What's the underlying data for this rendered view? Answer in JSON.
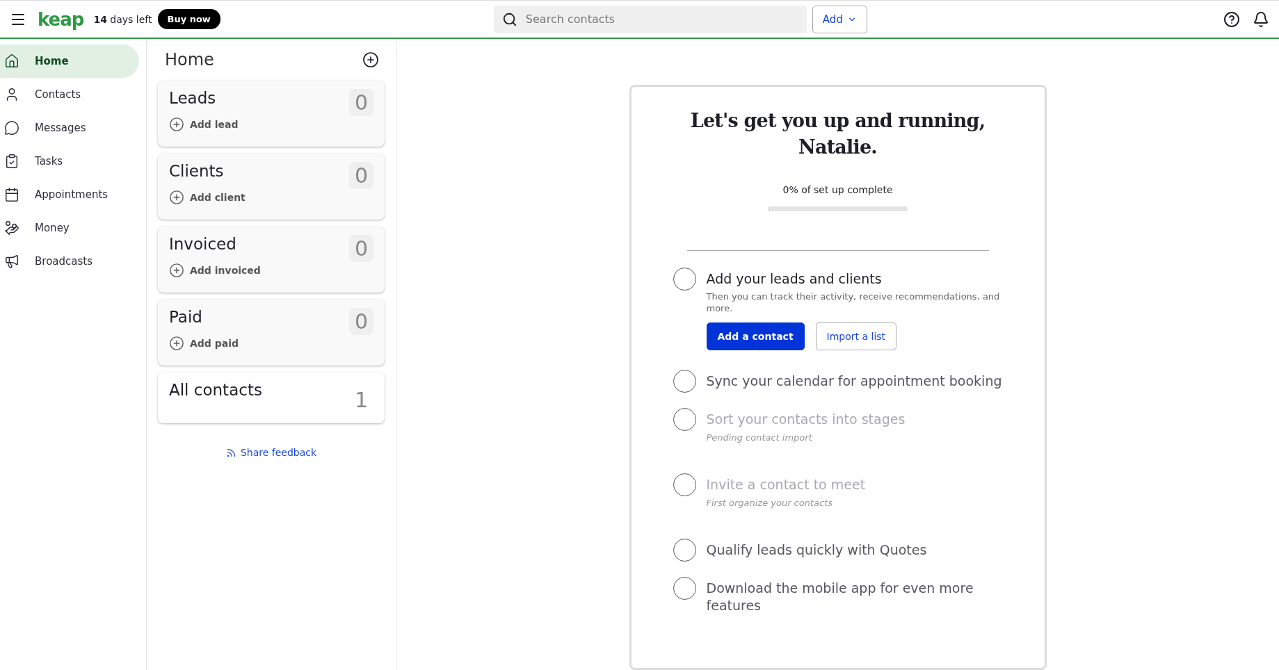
{
  "topbar": {
    "logo": "keap",
    "trial": {
      "count": "14",
      "label": "days left"
    },
    "buy_button": "Buy now",
    "search": {
      "placeholder": "Search contacts"
    },
    "add_button": "Add"
  },
  "sidebar": {
    "items": [
      {
        "label": "Home",
        "selected": true
      },
      {
        "label": "Contacts",
        "selected": false
      },
      {
        "label": "Messages",
        "selected": false
      },
      {
        "label": "Tasks",
        "selected": false
      },
      {
        "label": "Appointments",
        "selected": false
      },
      {
        "label": "Money",
        "selected": false
      },
      {
        "label": "Broadcasts",
        "selected": false
      }
    ]
  },
  "pipeline": {
    "title": "Home",
    "stages": [
      {
        "kind": "stage",
        "name": "Leads",
        "count": "0",
        "action": "Add lead"
      },
      {
        "kind": "stage",
        "name": "Clients",
        "count": "0",
        "action": "Add client"
      },
      {
        "kind": "stage",
        "name": "Invoiced",
        "count": "0",
        "action": "Add invoiced"
      },
      {
        "kind": "stage",
        "name": "Paid",
        "count": "0",
        "action": "Add paid"
      },
      {
        "kind": "total",
        "name": "All contacts",
        "count": "1"
      }
    ],
    "feedback_link": "Share feedback"
  },
  "setup": {
    "title": "Let's get you up and running, Natalie.",
    "progress_text": "0% of set up complete",
    "level": 0,
    "tasks": [
      {
        "title": "Add your leads and clients",
        "description": "Then you can track their activity, receive recommendations, and more.",
        "buttons": [
          {
            "label": "Add a contact",
            "primary": true
          },
          {
            "label": "Import a list",
            "primary": false
          }
        ],
        "checked": false,
        "disabled": false
      },
      {
        "title": "Sync your calendar for appointment booking",
        "checked": false,
        "disabled": false
      },
      {
        "title": "Sort your contacts into stages",
        "note": "Pending contact import",
        "checked": false,
        "disabled": true
      },
      {
        "title": "Invite a contact to meet",
        "note": "First organize your contacts",
        "checked": false,
        "disabled": true
      },
      {
        "title": "Qualify leads quickly with Quotes",
        "checked": false,
        "disabled": false
      },
      {
        "title": "Download the mobile app for even more features",
        "checked": false,
        "disabled": false
      }
    ]
  }
}
